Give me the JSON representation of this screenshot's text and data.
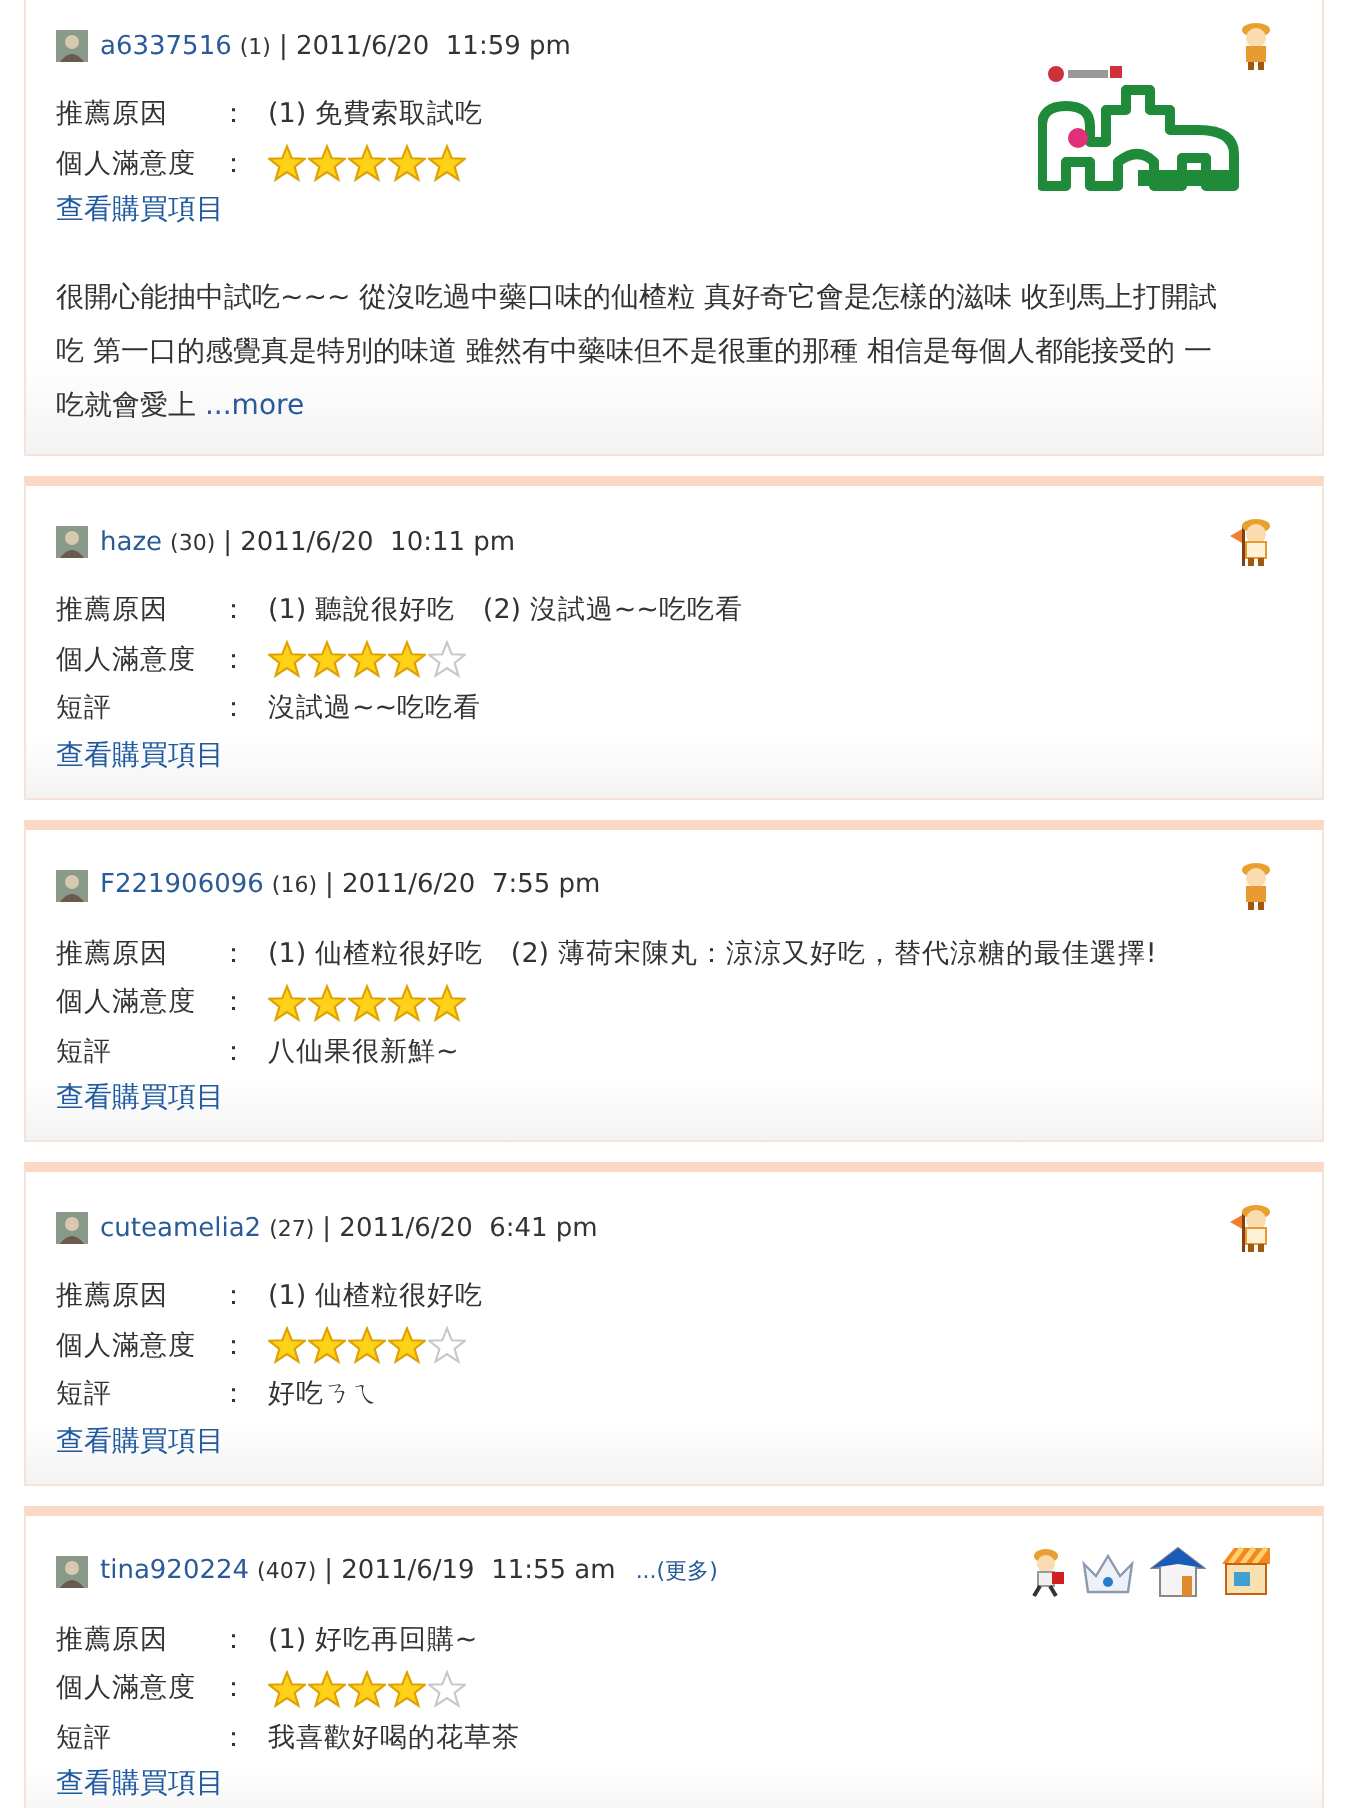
{
  "reviews": [
    {
      "user": "a6337516",
      "count": "(1)",
      "date": "| 2011/6/20  11:59 pm",
      "badges": [
        {
          "kind": "farmer"
        }
      ],
      "logo": true,
      "rows": [
        {
          "kind": "reasons",
          "label": "推薦原因",
          "colon": "：",
          "items": [
            "(1) 免費索取試吃"
          ]
        },
        {
          "kind": "stars",
          "label": "個人滿意度",
          "colon": "：",
          "stars": 5
        }
      ],
      "link": "查看購買項目",
      "body": "很開心能抽中試吃~~~ 從沒吃過中藥口味的仙楂粒 真好奇它會是怎樣的滋味 收到馬上打開試吃 第一口的感覺真是特別的味道 雖然有中藥味但不是很重的那種 相信是每個人都能接受的 一吃就會愛上",
      "more": "...more"
    },
    {
      "user": "haze",
      "count": "(30)",
      "date": "| 2011/6/20  10:11 pm",
      "badges": [
        {
          "kind": "flag-farmer"
        }
      ],
      "rows": [
        {
          "kind": "reasons",
          "label": "推薦原因",
          "colon": "：",
          "items": [
            "(1) 聽說很好吃",
            "(2) 沒試過~~吃吃看"
          ]
        },
        {
          "kind": "stars",
          "label": "個人滿意度",
          "colon": "：",
          "stars": 4
        },
        {
          "kind": "text",
          "label": "短評",
          "colon": "：",
          "value": "沒試過~~吃吃看"
        }
      ],
      "link": "查看購買項目"
    },
    {
      "user": "F221906096",
      "count": "(16)",
      "date": "| 2011/6/20  7:55 pm",
      "badges": [
        {
          "kind": "farmer"
        }
      ],
      "rows": [
        {
          "kind": "reasons",
          "label": "推薦原因",
          "colon": "：",
          "items": [
            "(1) 仙楂粒很好吃",
            "(2) 薄荷宋陳丸：涼涼又好吃，替代涼糖的最佳選擇!"
          ]
        },
        {
          "kind": "stars",
          "label": "個人滿意度",
          "colon": "：",
          "stars": 5
        },
        {
          "kind": "text",
          "label": "短評",
          "colon": "：",
          "value": "八仙果很新鮮~"
        }
      ],
      "link": "查看購買項目"
    },
    {
      "user": "cuteamelia2",
      "count": "(27)",
      "date": "| 2011/6/20  6:41 pm",
      "badges": [
        {
          "kind": "flag-farmer"
        }
      ],
      "rows": [
        {
          "kind": "reasons",
          "label": "推薦原因",
          "colon": "：",
          "items": [
            "(1) 仙楂粒很好吃"
          ]
        },
        {
          "kind": "stars",
          "label": "個人滿意度",
          "colon": "：",
          "stars": 4
        },
        {
          "kind": "text",
          "label": "短評",
          "colon": "：",
          "value": "好吃ㄋㄟ"
        }
      ],
      "link": "查看購買項目"
    },
    {
      "user": "tina920224",
      "count": "(407)",
      "date": "| 2011/6/19  11:55 am",
      "extra": "...(更多)",
      "badges": [
        {
          "kind": "runner"
        },
        {
          "kind": "crown"
        },
        {
          "kind": "house"
        },
        {
          "kind": "shop"
        }
      ],
      "rows": [
        {
          "kind": "reasons",
          "label": "推薦原因",
          "colon": "：",
          "items": [
            "(1) 好吃再回購~"
          ]
        },
        {
          "kind": "stars",
          "label": "個人滿意度",
          "colon": "：",
          "stars": 4
        },
        {
          "kind": "text",
          "label": "短評",
          "colon": "：",
          "value": "我喜歡好喝的花草茶"
        }
      ],
      "link": "查看購買項目"
    }
  ]
}
